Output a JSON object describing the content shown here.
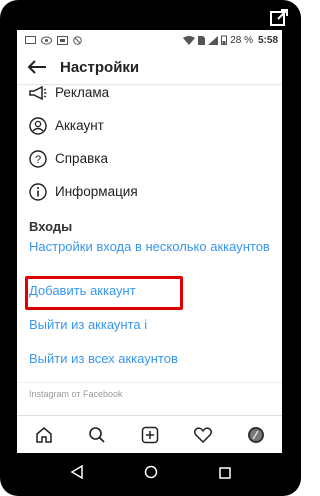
{
  "status": {
    "battery": "28 %",
    "time": "5:58"
  },
  "header": {
    "title": "Настройки"
  },
  "menu": [
    {
      "label": "Реклама",
      "icon": "megaphone-icon"
    },
    {
      "label": "Аккаунт",
      "icon": "account-icon"
    },
    {
      "label": "Справка",
      "icon": "help-icon"
    },
    {
      "label": "Информация",
      "icon": "info-icon"
    }
  ],
  "logins": {
    "section": "Входы",
    "multi_login": "Настройки входа в несколько аккаунтов",
    "add_account": "Добавить аккаунт",
    "logout_one": "Выйти из аккаунта",
    "logout_one_suffix": "i",
    "logout_all": "Выйти из всех аккаунтов"
  },
  "footer": "Instagram от Facebook",
  "colors": {
    "link": "#3897f0",
    "highlight": "#e00000"
  }
}
